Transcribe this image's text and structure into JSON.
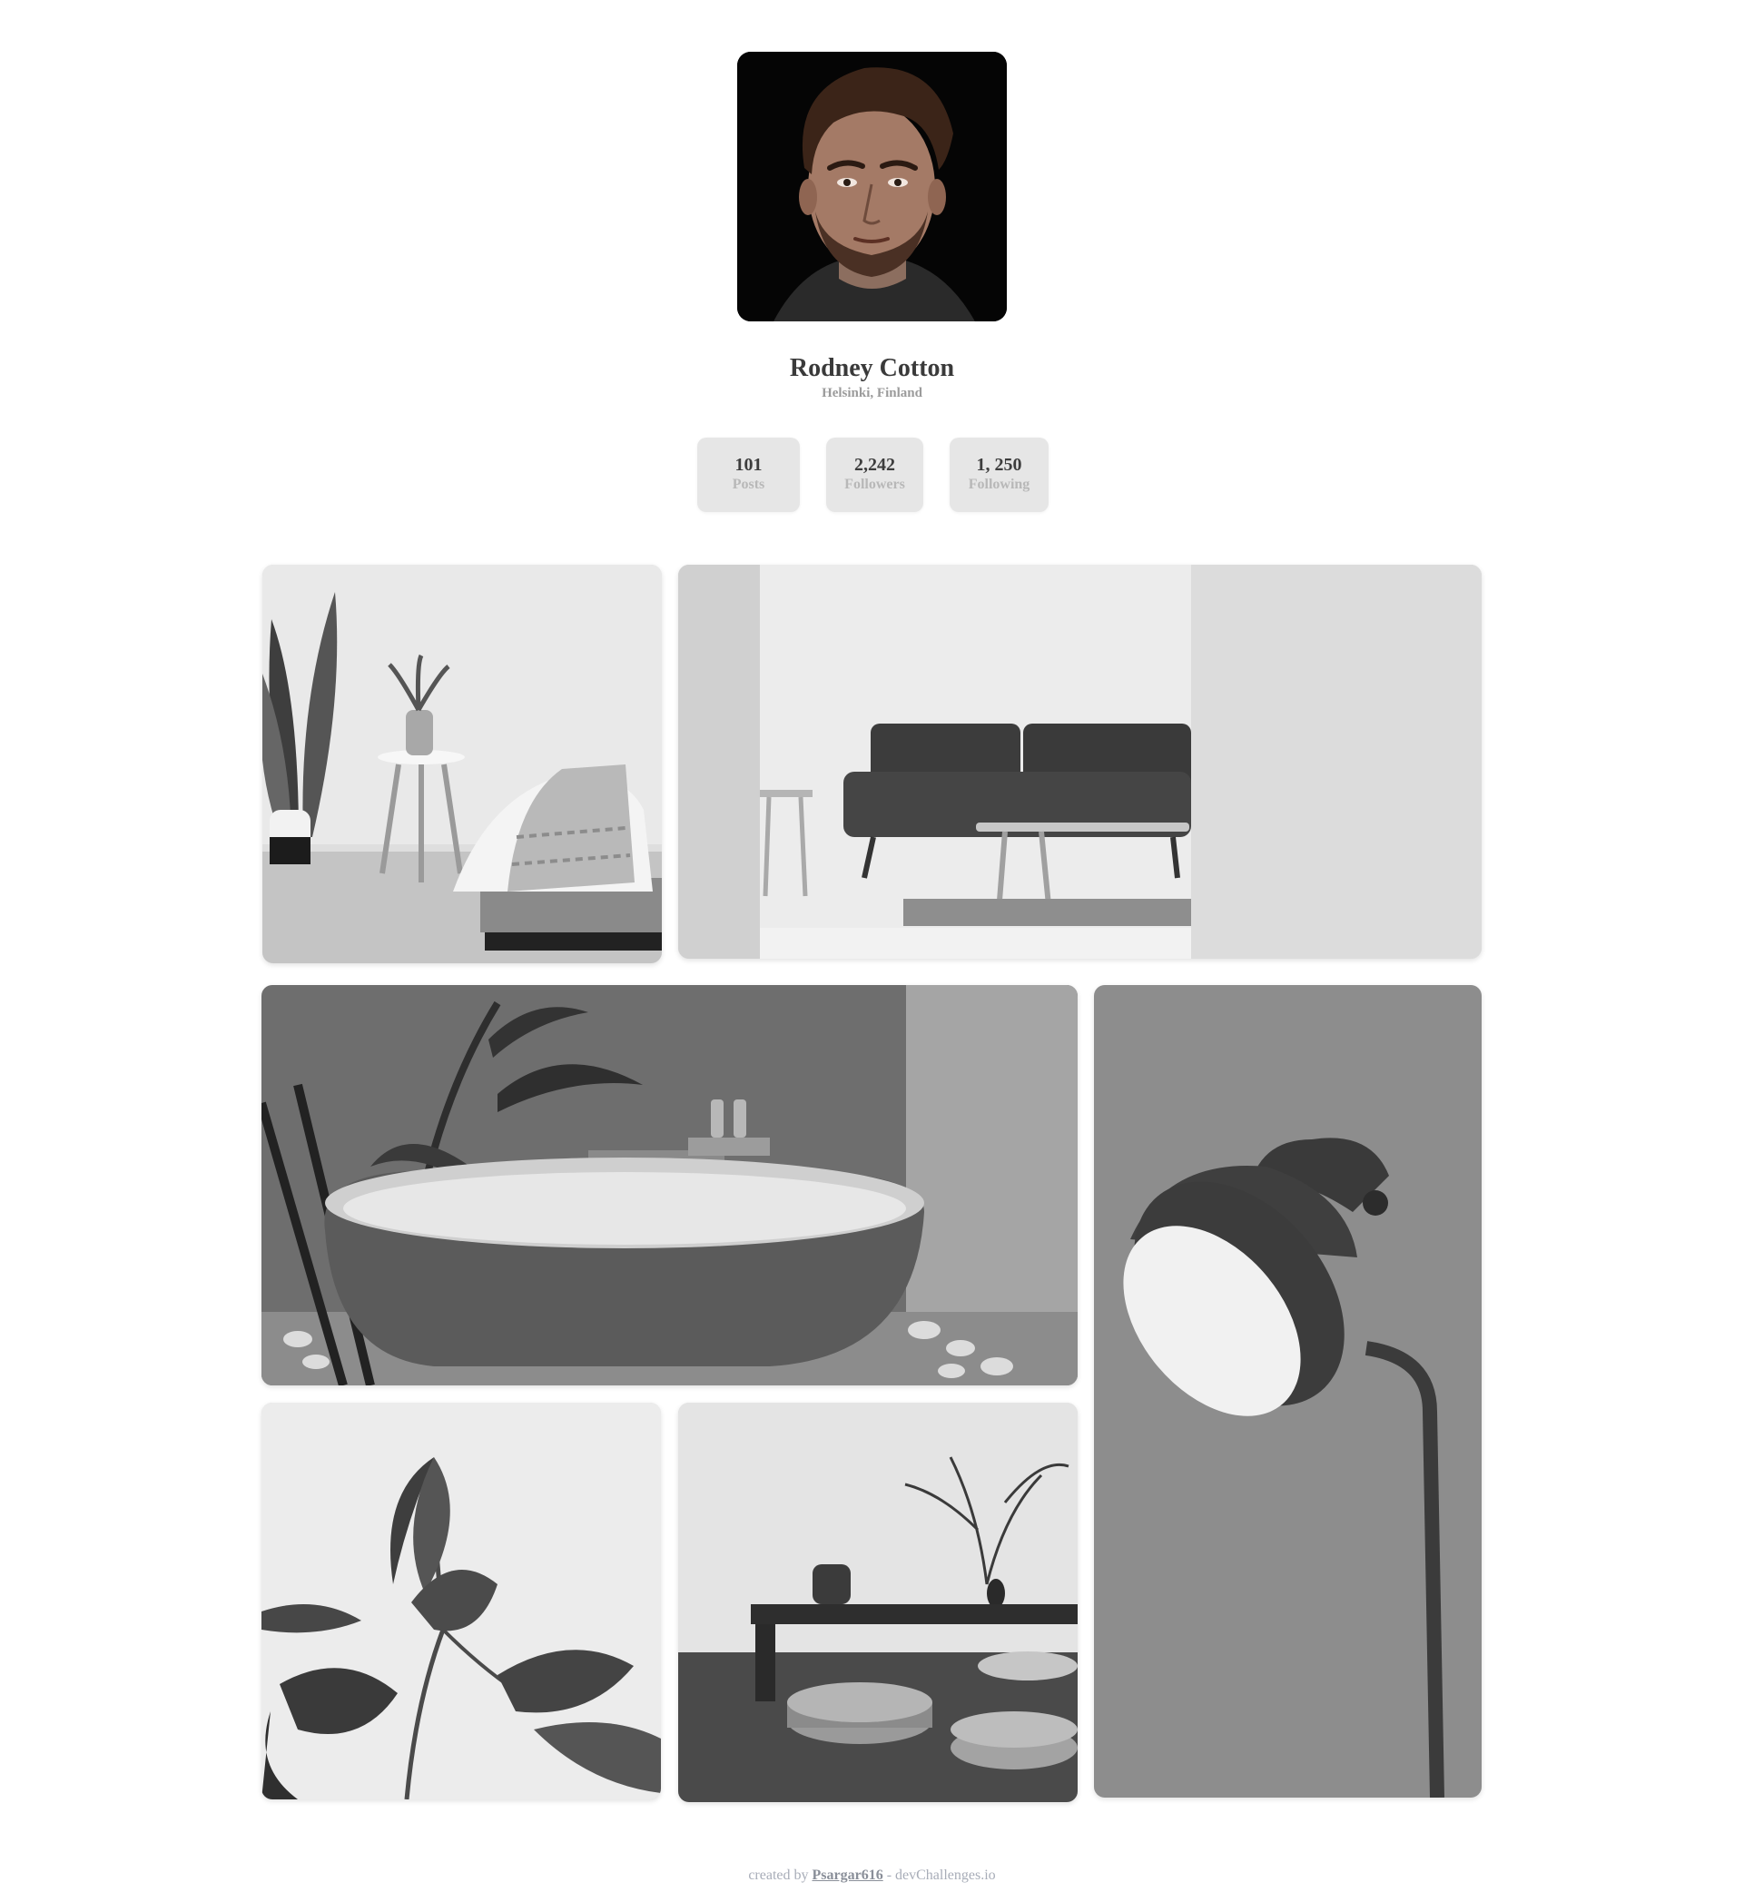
{
  "profile": {
    "name": "Rodney Cotton",
    "location": "Helsinki, Finland"
  },
  "stats": [
    {
      "value": "101",
      "label": "Posts"
    },
    {
      "value": "2,242",
      "label": "Followers"
    },
    {
      "value": "1, 250",
      "label": "Following"
    }
  ],
  "gallery": [
    {
      "subject": "bedroom-with-plant-and-stool"
    },
    {
      "subject": "living-room-sofa-and-table"
    },
    {
      "subject": "bathtub-with-palm"
    },
    {
      "subject": "floor-lamp"
    },
    {
      "subject": "rubber-plant-leaves"
    },
    {
      "subject": "low-table-with-floor-cushions"
    }
  ],
  "footer": {
    "prefix": "created by",
    "author": "Psargar616",
    "suffix": "- devChallenges.io"
  },
  "colors": {
    "card_background": "#e6e6e6",
    "name_text": "#3a3a3a",
    "muted_text": "#9b9b9b",
    "footer_text": "#a8adb8"
  }
}
